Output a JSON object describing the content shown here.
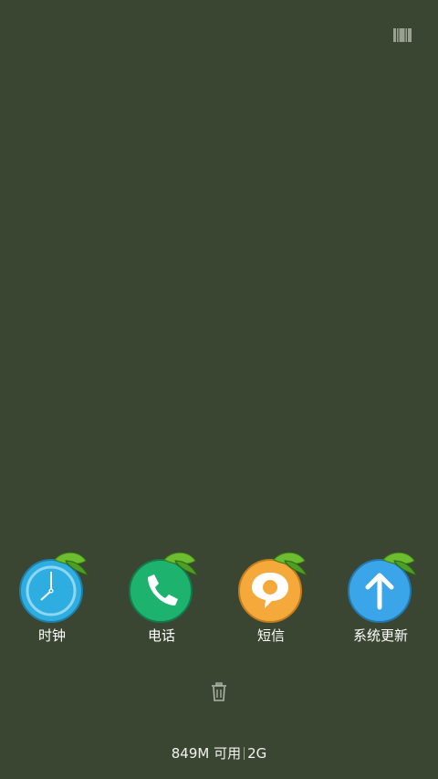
{
  "apps": [
    {
      "label": "时钟",
      "icon": "clock-icon",
      "color": "#2eaee0"
    },
    {
      "label": "电话",
      "icon": "phone-icon",
      "color": "#1db36f"
    },
    {
      "label": "短信",
      "icon": "message-icon",
      "color": "#f5a93b"
    },
    {
      "label": "系统更新",
      "icon": "system-update-icon",
      "color": "#3aa5e8"
    }
  ],
  "status": {
    "memory_available": "849M 可用",
    "memory_total": "2G"
  },
  "icons": {
    "top_right": "barcode-icon",
    "clear": "trash-icon"
  }
}
